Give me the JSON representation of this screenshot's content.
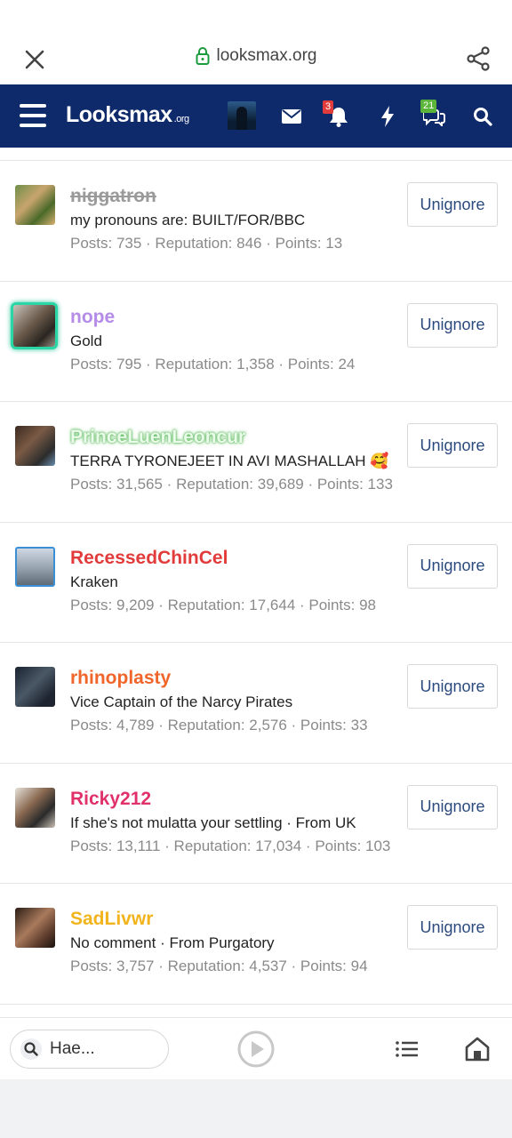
{
  "browser": {
    "url": "looksmax.org"
  },
  "header": {
    "logo_main": "Looksmax",
    "logo_suffix": ".org",
    "notifications_badge": "3",
    "conversations_badge": "21"
  },
  "colors": {
    "header_bg": "#0f2a6b",
    "button_text": "#2b4a7d"
  },
  "users": [
    {
      "name": "niggatron",
      "name_color": "#9a9a9a",
      "strike": true,
      "title": "my pronouns are: BUILT/FOR/BBC",
      "stats": "Posts: 735 · Reputation: 846 · Points: 13",
      "button": "Unignore"
    },
    {
      "name": "nope",
      "name_color": "#b58be8",
      "strike": false,
      "title": "Gold",
      "stats": "Posts: 795 · Reputation: 1,358 · Points: 24",
      "button": "Unignore"
    },
    {
      "name": "PrinceLuenLeoncur",
      "name_color": "#c7f0c7",
      "strike": false,
      "title": "TERRA TYRONEJEET IN AVI MASHALLAH 🥰",
      "stats": "Posts: 31,565 · Reputation: 39,689 · Points: 133",
      "button": "Unignore"
    },
    {
      "name": "RecessedChinCel",
      "name_color": "#e23b3b",
      "strike": false,
      "title": "Kraken",
      "stats": "Posts: 9,209 · Reputation: 17,644 · Points: 98",
      "button": "Unignore"
    },
    {
      "name": "rhinoplasty",
      "name_color": "#f0652a",
      "strike": false,
      "title": "Vice Captain of the Narcy Pirates",
      "stats": "Posts: 4,789 · Reputation: 2,576 · Points: 33",
      "button": "Unignore"
    },
    {
      "name": "Ricky212",
      "name_color": "#e0316b",
      "strike": false,
      "title": "If she's not mulatta your settling · From UK",
      "stats": "Posts: 13,111 · Reputation: 17,034 · Points: 103",
      "button": "Unignore"
    },
    {
      "name": "SadLivwr",
      "name_color": "#f2b41c",
      "strike": false,
      "title": "No comment · From Purgatory",
      "stats": "Posts: 3,757 · Reputation: 4,537 · Points: 94",
      "button": "Unignore"
    }
  ],
  "bottom": {
    "search_text": "Hae..."
  }
}
